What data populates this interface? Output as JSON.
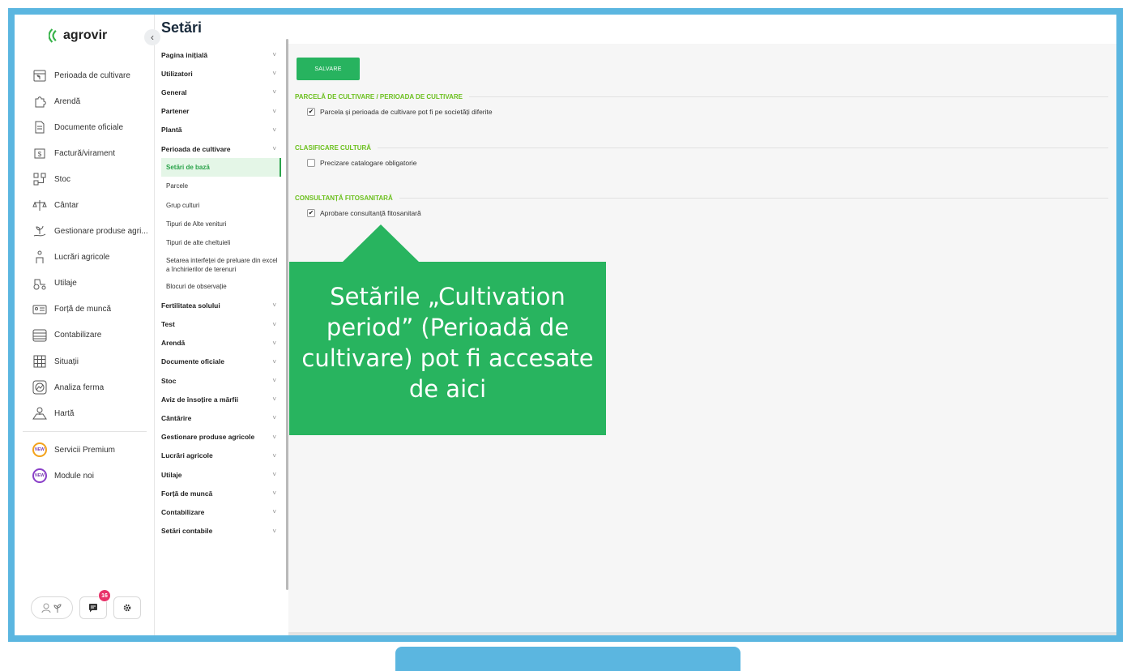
{
  "app": {
    "logo_text": "agrovir",
    "collapse_glyph": "‹"
  },
  "nav": {
    "items": [
      {
        "label": "Perioada de cultivare",
        "icon": "calendar-plant-icon"
      },
      {
        "label": "Arendă",
        "icon": "puzzle-icon"
      },
      {
        "label": "Documente oficiale",
        "icon": "document-icon"
      },
      {
        "label": "Factură/virament",
        "icon": "invoice-icon"
      },
      {
        "label": "Stoc",
        "icon": "stock-icon"
      },
      {
        "label": "Cântar",
        "icon": "scale-icon"
      },
      {
        "label": "Gestionare produse agri...",
        "icon": "plant-hand-icon"
      },
      {
        "label": "Lucrări agricole",
        "icon": "field-work-icon"
      },
      {
        "label": "Utilaje",
        "icon": "tractor-icon"
      },
      {
        "label": "Forță de muncă",
        "icon": "id-card-icon"
      },
      {
        "label": "Contabilizare",
        "icon": "abacus-icon"
      },
      {
        "label": "Situații",
        "icon": "grid-report-icon"
      },
      {
        "label": "Analiza ferma",
        "icon": "chart-circle-icon"
      },
      {
        "label": "Hartă",
        "icon": "map-icon"
      }
    ],
    "premium": [
      {
        "label": "Servicii Premium",
        "icon_text": "NEW"
      },
      {
        "label": "Module noi",
        "icon_text": "NEW"
      }
    ],
    "badge_count": "16",
    "accent": "#38b34a"
  },
  "settings": {
    "title": "Setări",
    "top_items": [
      "Pagina inițială",
      "Utilizatori",
      "General",
      "Partener",
      "Plantă",
      "Perioada de cultivare"
    ],
    "sub_items": [
      "Setări de bază",
      "Parcele",
      "Grup culturi",
      "Tipuri de Alte venituri",
      "Tipuri de alte cheltuieli",
      "Setarea interfeței de preluare din excel a închirierilor de terenuri",
      "Blocuri de observație"
    ],
    "bottom_items": [
      "Fertilitatea solului",
      "Test",
      "Arendă",
      "Documente oficiale",
      "Stoc",
      "Aviz de însoțire a mărfii",
      "Cântărire",
      "Gestionare produse agricole",
      "Lucrări agricole",
      "Utilaje",
      "Forță de muncă",
      "Contabilizare",
      "Setări contabile"
    ],
    "chevron": "˅"
  },
  "main": {
    "save_label": "SALVARE",
    "sections": [
      {
        "title": "PARCELĂ DE CULTIVARE / PERIOADA DE CULTIVARE",
        "option": "Parcela și perioada de cultivare pot fi pe societăți diferite",
        "checked": "✔"
      },
      {
        "title": "CLASIFICARE CULTURĂ",
        "option": "Precizare catalogare obligatorie",
        "checked": ""
      },
      {
        "title": "CONSULTANȚĂ FITOSANITARĂ",
        "option": "Aprobare consultanță fitosanitară",
        "checked": "✔"
      }
    ]
  },
  "callout": {
    "text": "Setările „Cultivation period” (Perioadă de cultivare) pot fi accesate de aici",
    "color": "#28b45f"
  }
}
